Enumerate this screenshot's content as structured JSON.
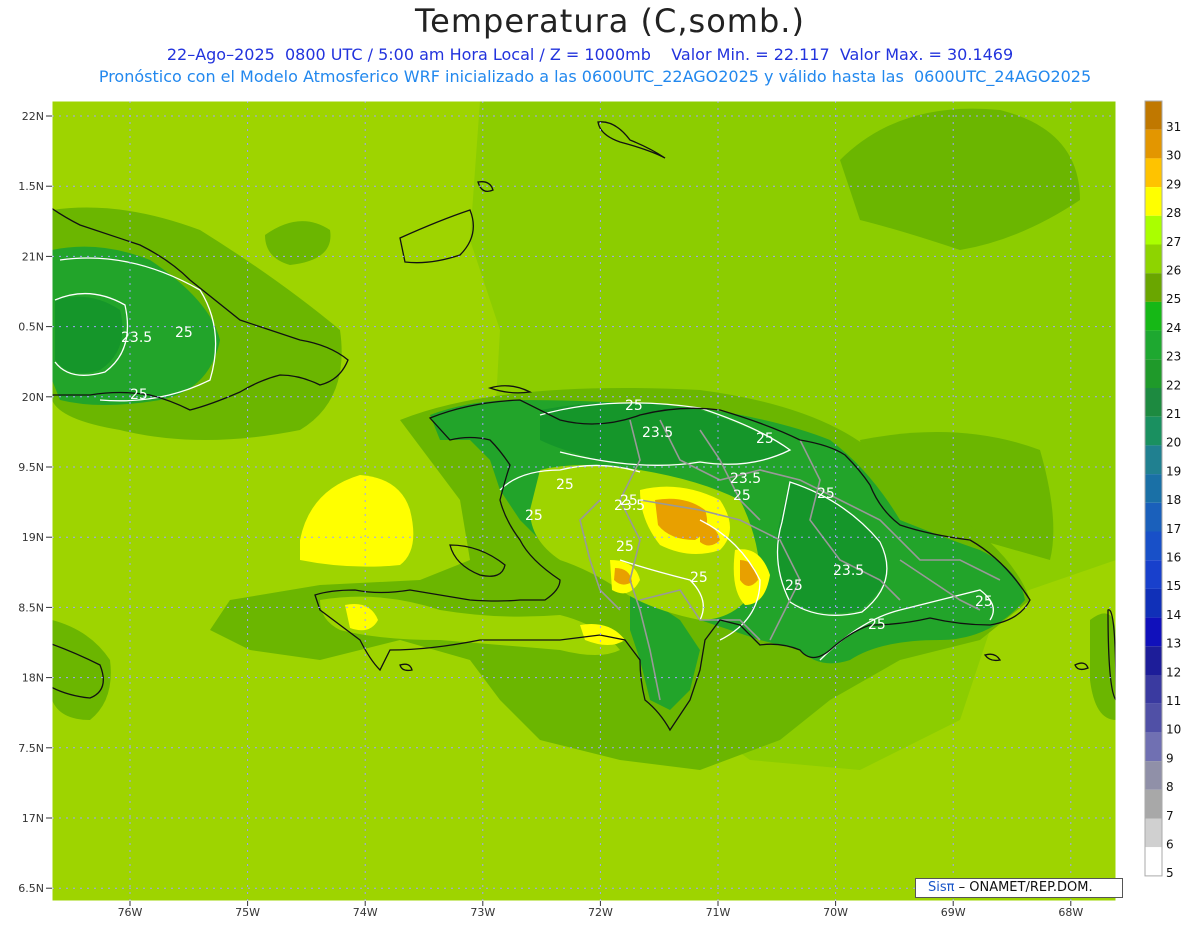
{
  "header": {
    "title": "Temperatura (C,somb.)",
    "subtitle_1": "22–Ago–2025  0800 UTC / 5:00 am Hora Local / Z = 1000mb    Valor Min. = 22.117  Valor Max. = 30.1469",
    "subtitle_2": "Pronóstico con el Modelo Atmosferico WRF inicializado a las 0600UTC_22AGO2025 y válido hasta las  0600UTC_24AGO2025"
  },
  "map_data": {
    "type": "filled-contour map",
    "lat_labels": [
      "22N",
      "1.5N",
      "21N",
      "0.5N",
      "20N",
      "9.5N",
      "19N",
      "8.5N",
      "18N",
      "7.5N",
      "17N",
      "6.5N"
    ],
    "lon_labels": [
      "76W",
      "75W",
      "74W",
      "73W",
      "72W",
      "71W",
      "70W",
      "69W",
      "68W"
    ],
    "contour_labels": [
      "23.5",
      "25",
      "25",
      "23.5",
      "25",
      "25",
      "23.5",
      "25",
      "25",
      "25",
      "25",
      "23.5",
      "25",
      "25",
      "25",
      "23.5",
      "25",
      "25",
      "25"
    ],
    "grid": true,
    "colors": {
      "background_field": "#9ed400",
      "ocean_east": "#8ccd00",
      "cool_band": "#6bb600",
      "land_green": "#22a42a",
      "land_dark": "#15962a",
      "warm_yellow": "#ffff00",
      "warm_orange": "#e8a000"
    }
  },
  "colorbar": {
    "labels": [
      "31",
      "30",
      "29",
      "28",
      "27",
      "26",
      "25",
      "24",
      "23",
      "22",
      "21",
      "20",
      "19",
      "18",
      "17",
      "16",
      "15",
      "14",
      "13",
      "12",
      "11",
      "10",
      "9",
      "8",
      "7",
      "6",
      "5"
    ],
    "colors": [
      "#c07800",
      "#e39600",
      "#ffc300",
      "#ffff00",
      "#aaff00",
      "#8ed400",
      "#6aa600",
      "#16b816",
      "#1ea830",
      "#1f9a2a",
      "#1d8a40",
      "#1a9060",
      "#208090",
      "#1a70a6",
      "#1a60bb",
      "#1850c8",
      "#1840cc",
      "#1030b8",
      "#1010bb",
      "#1d1d99",
      "#3a3aa0",
      "#5050a6",
      "#7070b2",
      "#9090a8",
      "#a8a8a8",
      "#d0d0d0",
      "#ffffff"
    ]
  },
  "credit": {
    "logo": "Sisπ",
    "text": "– ONAMET/REP.DOM."
  }
}
